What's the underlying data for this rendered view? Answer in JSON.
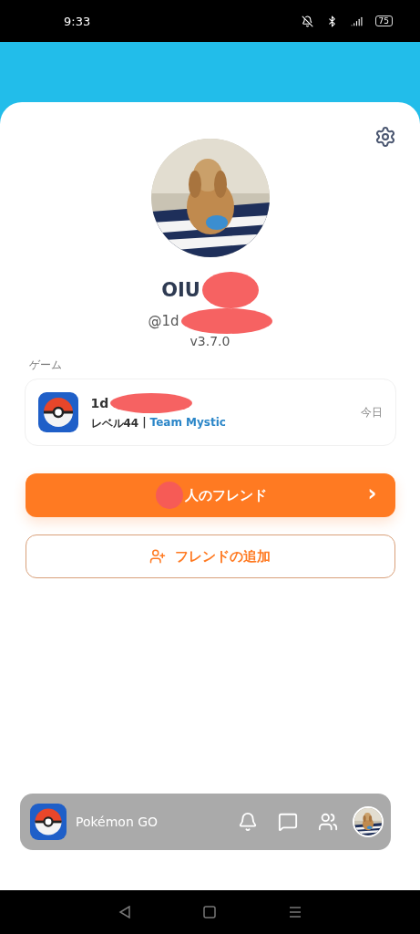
{
  "status_bar": {
    "time": "9:33",
    "battery": "75"
  },
  "profile": {
    "name": "OIU",
    "handle": "@1d",
    "version": "v3.7.0"
  },
  "game_section": {
    "label": "ゲーム",
    "game": {
      "player": "1d",
      "level": "レベル44",
      "separator": "|",
      "team": "Team Mystic",
      "date": "今日"
    }
  },
  "friends_button": {
    "label": "人のフレンド",
    "chevron": "›"
  },
  "add_friend_button": {
    "label": "フレンドの追加"
  },
  "bottom_bar": {
    "app_name": "Pokémon GO"
  }
}
